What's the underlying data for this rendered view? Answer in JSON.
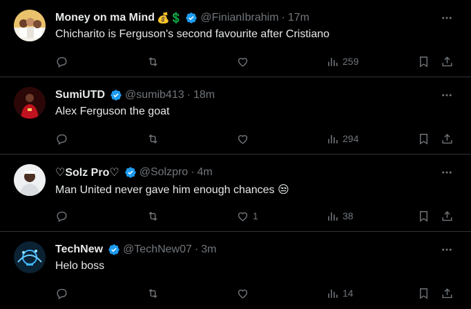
{
  "tweets": [
    {
      "name": "Money on ma Mind",
      "name_emoji": "💰💲",
      "handle": "@FinianIbrahim",
      "separator": "·",
      "time": "17m",
      "text": "Chicharito is Ferguson's second favourite after Cristiano",
      "likes": "",
      "views": "259"
    },
    {
      "name": "SumiUTD",
      "name_emoji": "",
      "handle": "@sumib413",
      "separator": "·",
      "time": "18m",
      "text": "Alex Ferguson the goat",
      "likes": "",
      "views": "294"
    },
    {
      "name": "♡Solz Pro♡",
      "name_emoji": "",
      "handle": "@Solzpro",
      "separator": "·",
      "time": "4m",
      "text": "Man United never gave him enough chances 😒",
      "likes": "1",
      "views": "38"
    },
    {
      "name": "TechNew",
      "name_emoji": "",
      "handle": "@TechNew07",
      "separator": "·",
      "time": "3m",
      "text": "Helo boss",
      "likes": "",
      "views": "14"
    }
  ],
  "colors": {
    "background": "#000000",
    "text": "#e7e9ea",
    "muted": "#71767b",
    "divider": "#2f3336",
    "verified": "#1d9bf0"
  },
  "icons": [
    "verified-badge-icon",
    "more-icon",
    "reply-icon",
    "retweet-icon",
    "like-icon",
    "views-icon",
    "bookmark-icon",
    "share-icon"
  ]
}
